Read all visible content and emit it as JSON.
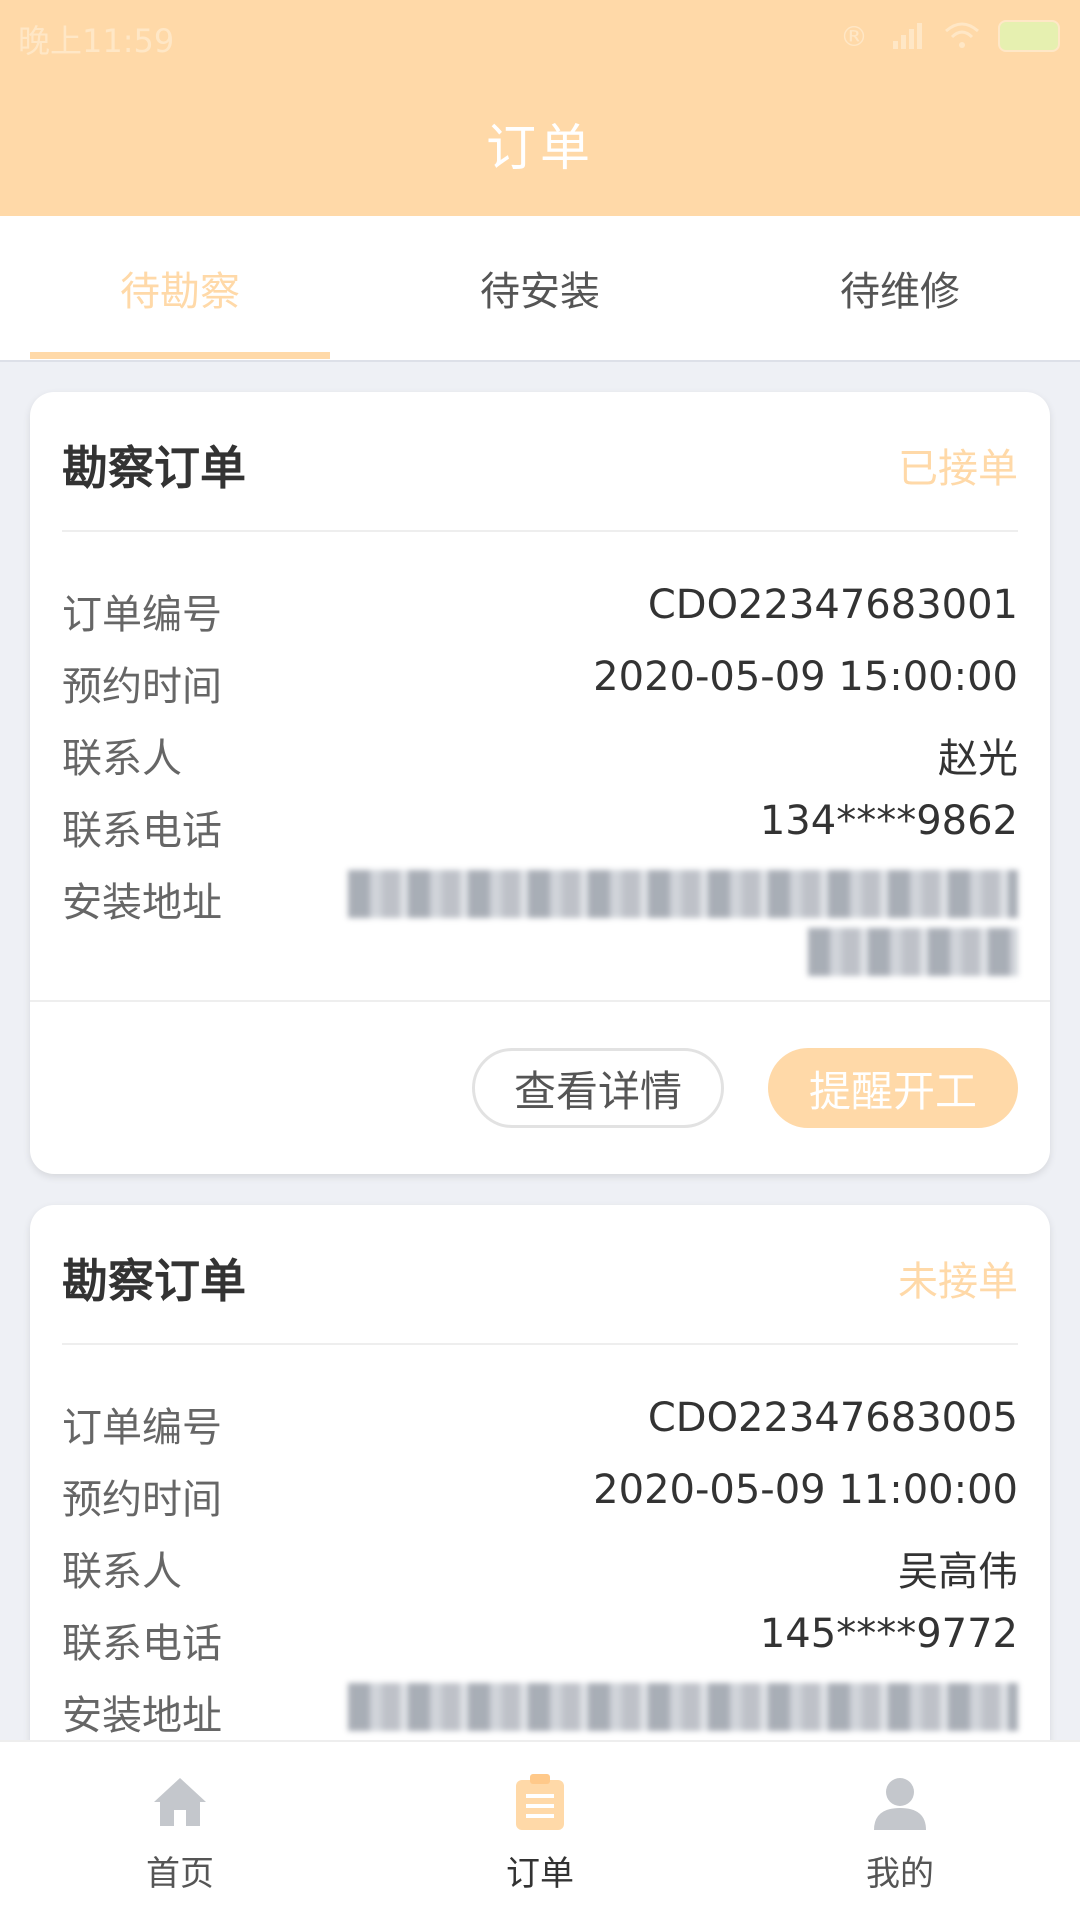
{
  "status_bar": {
    "time": "晚上11:59"
  },
  "header": {
    "title": "订单"
  },
  "tabs": [
    {
      "label": "待勘察",
      "active": true
    },
    {
      "label": "待安装",
      "active": false
    },
    {
      "label": "待维修",
      "active": false
    }
  ],
  "colors": {
    "accent": "#ffd9a8",
    "background": "#eef0f5"
  },
  "orders": [
    {
      "title": "勘察订单",
      "status": "已接单",
      "fields": [
        {
          "label": "订单编号",
          "value": "CDO22347683001"
        },
        {
          "label": "预约时间",
          "value": "2020-05-09 15:00:00"
        },
        {
          "label": "联系人",
          "value": "赵光"
        },
        {
          "label": "联系电话",
          "value": "134****9862"
        },
        {
          "label": "安装地址",
          "value": ""
        }
      ],
      "buttons": {
        "details": "查看详情",
        "remind": "提醒开工"
      }
    },
    {
      "title": "勘察订单",
      "status": "未接单",
      "fields": [
        {
          "label": "订单编号",
          "value": "CDO22347683005"
        },
        {
          "label": "预约时间",
          "value": "2020-05-09 11:00:00"
        },
        {
          "label": "联系人",
          "value": "吴高伟"
        },
        {
          "label": "联系电话",
          "value": "145****9772"
        },
        {
          "label": "安装地址",
          "value": ""
        }
      ]
    }
  ],
  "bottom_nav": [
    {
      "label": "首页",
      "icon": "home-icon",
      "active": false
    },
    {
      "label": "订单",
      "icon": "clipboard-icon",
      "active": true
    },
    {
      "label": "我的",
      "icon": "user-icon",
      "active": false
    }
  ]
}
